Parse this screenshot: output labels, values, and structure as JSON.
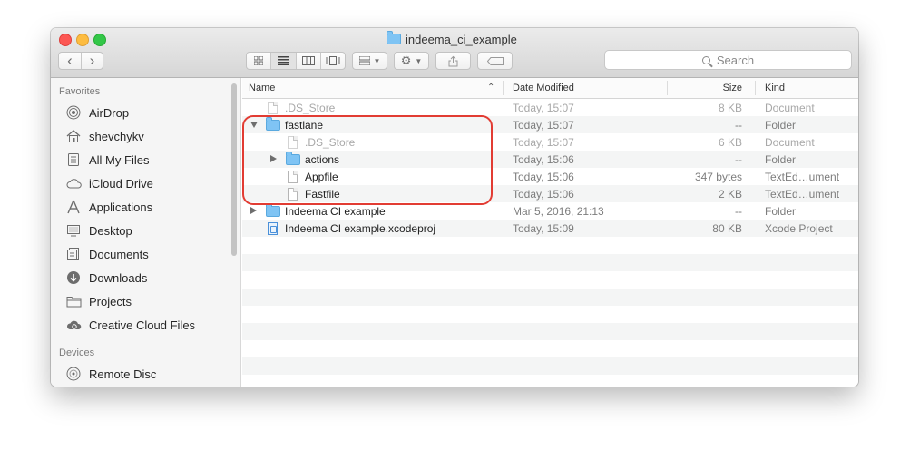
{
  "window": {
    "title": "indeema_ci_example"
  },
  "toolbar": {
    "search_placeholder": "Search",
    "nav_back": "‹",
    "nav_forward": "›"
  },
  "sidebar": {
    "favorites_heading": "Favorites",
    "devices_heading": "Devices",
    "favorites": [
      {
        "label": "AirDrop",
        "icon": "airdrop-icon"
      },
      {
        "label": "shevchykv",
        "icon": "home-icon"
      },
      {
        "label": "All My Files",
        "icon": "all-files-icon"
      },
      {
        "label": "iCloud Drive",
        "icon": "cloud-icon"
      },
      {
        "label": "Applications",
        "icon": "applications-icon"
      },
      {
        "label": "Desktop",
        "icon": "desktop-icon"
      },
      {
        "label": "Documents",
        "icon": "documents-icon"
      },
      {
        "label": "Downloads",
        "icon": "downloads-icon"
      },
      {
        "label": "Projects",
        "icon": "folder-icon"
      },
      {
        "label": "Creative Cloud Files",
        "icon": "creative-cloud-icon"
      }
    ],
    "devices": [
      {
        "label": "Remote Disc",
        "icon": "disc-icon"
      }
    ]
  },
  "columns": {
    "name": "Name",
    "date": "Date Modified",
    "size": "Size",
    "kind": "Kind"
  },
  "files": [
    {
      "name": ".DS_Store",
      "date": "Today, 15:07",
      "size": "8 KB",
      "kind": "Document",
      "icon": "document-icon",
      "dim": true
    },
    {
      "name": "fastlane",
      "date": "Today, 15:07",
      "size": "--",
      "kind": "Folder",
      "icon": "folder-icon",
      "expanded": true
    },
    {
      "name": ".DS_Store",
      "date": "Today, 15:07",
      "size": "6 KB",
      "kind": "Document",
      "icon": "document-icon",
      "dim": true
    },
    {
      "name": "actions",
      "date": "Today, 15:06",
      "size": "--",
      "kind": "Folder",
      "icon": "folder-icon",
      "expanded": false
    },
    {
      "name": "Appfile",
      "date": "Today, 15:06",
      "size": "347 bytes",
      "kind": "TextEd…ument",
      "icon": "document-icon"
    },
    {
      "name": "Fastfile",
      "date": "Today, 15:06",
      "size": "2 KB",
      "kind": "TextEd…ument",
      "icon": "document-icon"
    },
    {
      "name": "Indeema CI example",
      "date": "Mar 5, 2016, 21:13",
      "size": "--",
      "kind": "Folder",
      "icon": "folder-icon",
      "expanded": false
    },
    {
      "name": "Indeema CI example.xcodeproj",
      "date": "Today, 15:09",
      "size": "80 KB",
      "kind": "Xcode Project",
      "icon": "xcodeproj-icon"
    }
  ],
  "colors": {
    "highlight": "#e23c33",
    "folder": "#7fc4f4",
    "selected_view": "#e2e2e2"
  }
}
